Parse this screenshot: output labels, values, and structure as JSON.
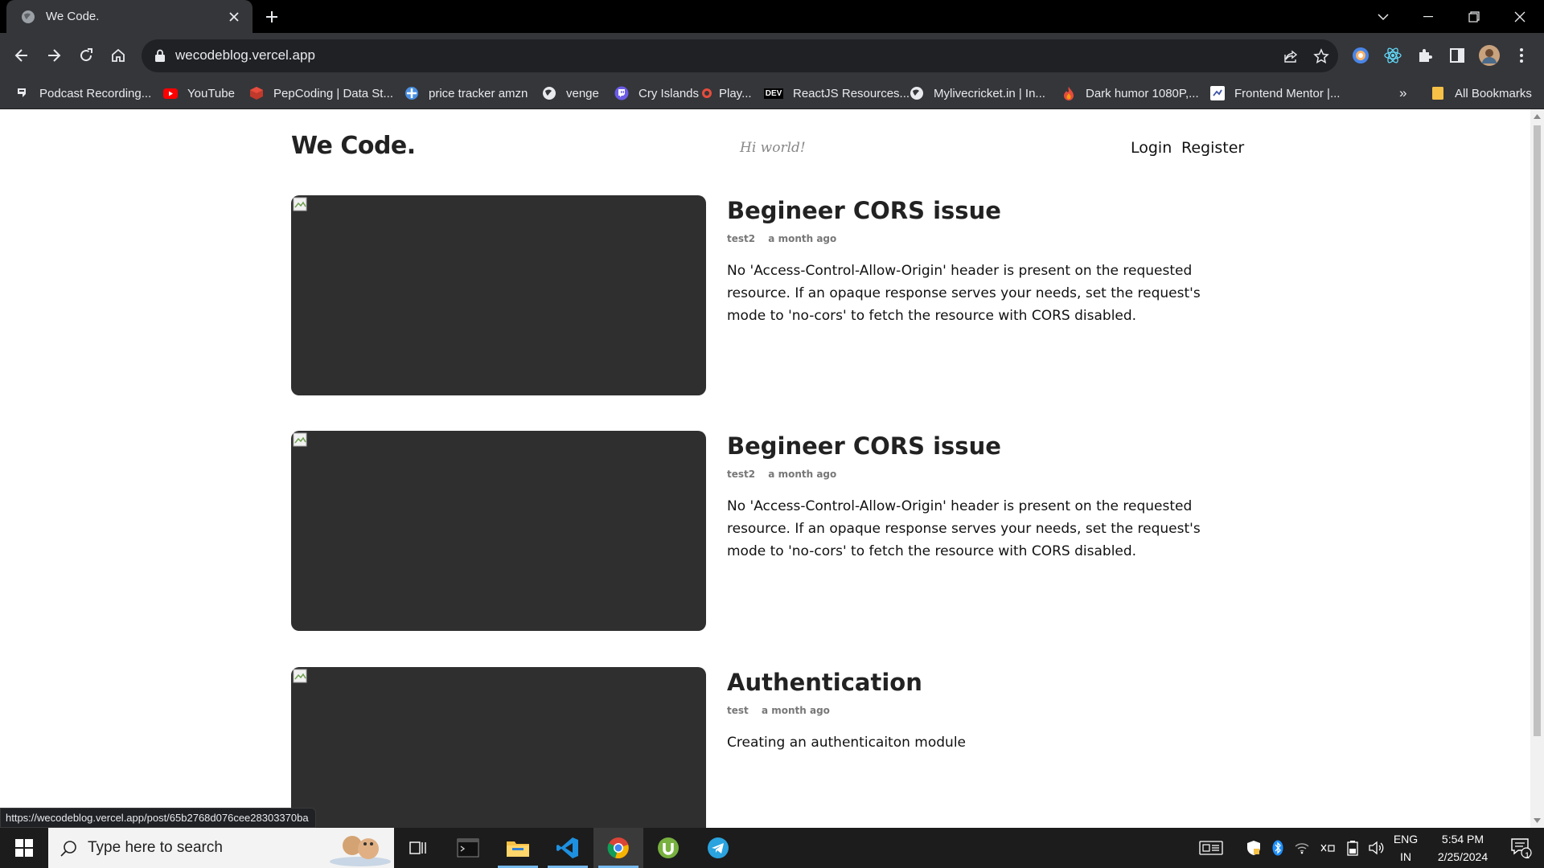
{
  "browser": {
    "tab_title": "We Code.",
    "url": "wecodeblog.vercel.app",
    "status_url": "https://wecodeblog.vercel.app/post/65b2768d076cee28303370ba",
    "bookmarks": [
      {
        "label": "Podcast Recording...",
        "icon": "podcast-icon"
      },
      {
        "label": "YouTube",
        "icon": "youtube-icon"
      },
      {
        "label": "PepCoding | Data St...",
        "icon": "pepcoding-icon"
      },
      {
        "label": "price tracker amzn",
        "icon": "tracker-icon"
      },
      {
        "label": "venge",
        "icon": "globe-icon"
      },
      {
        "label": "Cry Islands",
        "icon": "twitch-icon"
      },
      {
        "label": "Play...",
        "icon": "play-icon"
      },
      {
        "label": "ReactJS Resources...",
        "icon": "dev-icon"
      },
      {
        "label": "Mylivecricket.in | In...",
        "icon": "globe-icon"
      },
      {
        "label": "Dark humor 1080P,...",
        "icon": "flame-icon"
      },
      {
        "label": "Frontend Mentor |...",
        "icon": "frontend-mentor-icon"
      }
    ],
    "bookmarks_overflow": "»",
    "all_bookmarks": "All Bookmarks",
    "dev_badge": "DEV"
  },
  "site": {
    "logo": "We Code.",
    "greeting": "Hi world!",
    "nav": {
      "login": "Login",
      "register": "Register"
    },
    "posts": [
      {
        "title": "Begineer CORS issue",
        "author": "test2",
        "time": "a month ago",
        "summary": "No 'Access-Control-Allow-Origin' header is present on the requested resource. If an opaque response serves your needs, set the request's mode to 'no-cors' to fetch the resource with CORS disabled."
      },
      {
        "title": "Begineer CORS issue",
        "author": "test2",
        "time": "a month ago",
        "summary": "No 'Access-Control-Allow-Origin' header is present on the requested resource. If an opaque response serves your needs, set the request's mode to 'no-cors' to fetch the resource with CORS disabled."
      },
      {
        "title": "Authentication",
        "author": "test",
        "time": "a month ago",
        "summary": "Creating an authenticaiton module"
      }
    ]
  },
  "taskbar": {
    "search_placeholder": "Type here to search",
    "language": "ENG",
    "region": "IN",
    "time": "5:54 PM",
    "date": "2/25/2024",
    "notification_count": "1"
  },
  "colors": {
    "chrome_bg": "#35363a",
    "titlebar_bg": "#000000",
    "thumb_bg": "#2f2f2f",
    "taskbar_bg": "#1c1c1c"
  }
}
